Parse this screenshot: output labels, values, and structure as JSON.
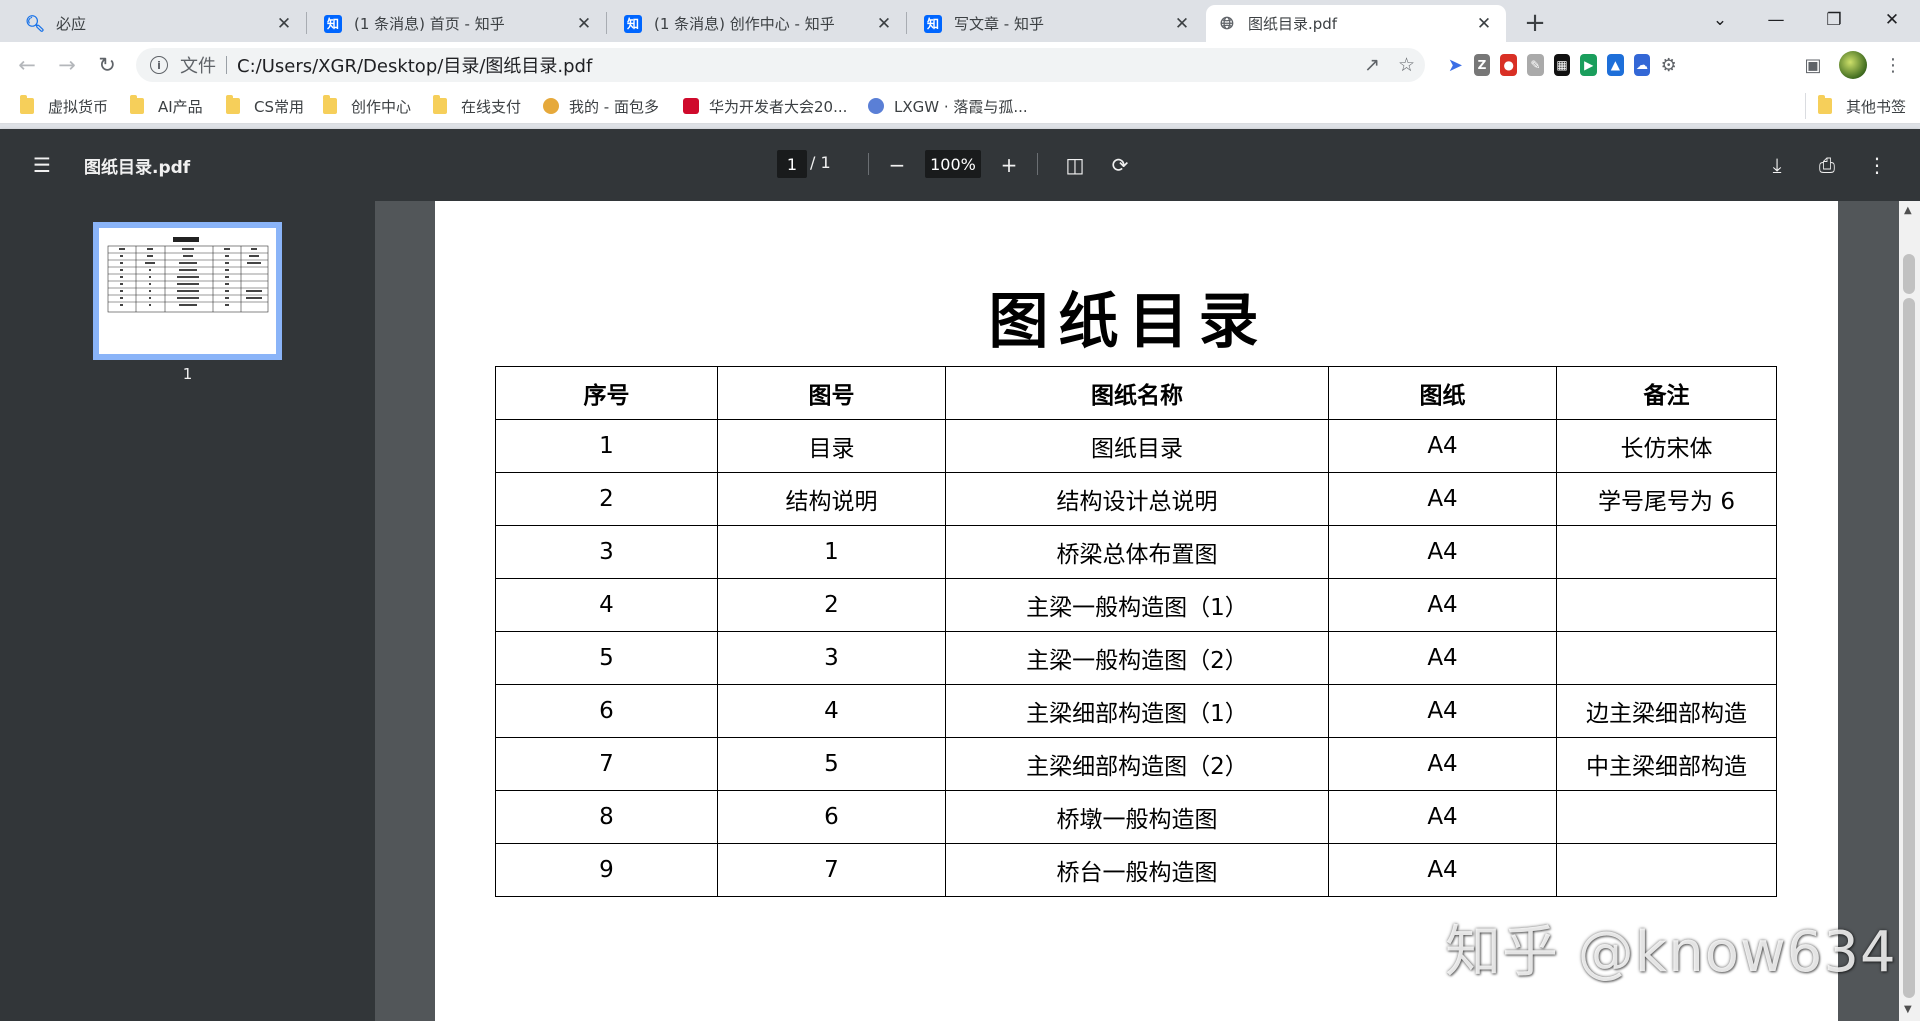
{
  "tabs": [
    {
      "title": "必应",
      "icon": "search-icon"
    },
    {
      "title": "(1 条消息) 首页 - 知乎",
      "icon": "zhihu-icon"
    },
    {
      "title": "(1 条消息) 创作中心 - 知乎",
      "icon": "zhihu-icon"
    },
    {
      "title": "写文章 - 知乎",
      "icon": "zhihu-icon"
    },
    {
      "title": "图纸目录.pdf",
      "icon": "globe-icon",
      "active": true
    }
  ],
  "zhihu_icon_text": "知",
  "address_bar": {
    "scheme": "文件",
    "url": "C:/Users/XGR/Desktop/目录/图纸目录.pdf"
  },
  "bookmarks": [
    {
      "label": "虚拟货币",
      "icon": "folder-icon"
    },
    {
      "label": "AI产品",
      "icon": "folder-icon"
    },
    {
      "label": "CS常用",
      "icon": "folder-icon"
    },
    {
      "label": "创作中心",
      "icon": "folder-icon"
    },
    {
      "label": "在线支付",
      "icon": "folder-icon"
    },
    {
      "label": "我的 - 面包多",
      "icon": "mianbaoduo-icon"
    },
    {
      "label": "华为开发者大会20...",
      "icon": "huawei-icon"
    },
    {
      "label": "LXGW · 落霞与孤...",
      "icon": "lxgw-icon"
    }
  ],
  "other_bookmarks": "其他书签",
  "pdf": {
    "filename": "图纸目录.pdf",
    "page_current": "1",
    "page_total": "/ 1",
    "zoom": "100%",
    "thumbnail_label": "1"
  },
  "document": {
    "title": "图纸目录",
    "headers": [
      "序号",
      "图号",
      "图纸名称",
      "图纸",
      "备注"
    ],
    "rows": [
      [
        "1",
        "目录",
        "图纸目录",
        "A4",
        "长仿宋体"
      ],
      [
        "2",
        "结构说明",
        "结构设计总说明",
        "A4",
        "学号尾号为 6"
      ],
      [
        "3",
        "1",
        "桥梁总体布置图",
        "A4",
        ""
      ],
      [
        "4",
        "2",
        "主梁一般构造图（1）",
        "A4",
        ""
      ],
      [
        "5",
        "3",
        "主梁一般构造图（2）",
        "A4",
        ""
      ],
      [
        "6",
        "4",
        "主梁细部构造图（1）",
        "A4",
        "边主梁细部构造"
      ],
      [
        "7",
        "5",
        "主梁细部构造图（2）",
        "A4",
        "中主梁细部构造"
      ],
      [
        "8",
        "6",
        "桥墩一般构造图",
        "A4",
        ""
      ],
      [
        "9",
        "7",
        "桥台一般构造图",
        "A4",
        ""
      ]
    ]
  },
  "watermark": "知乎 @know634"
}
